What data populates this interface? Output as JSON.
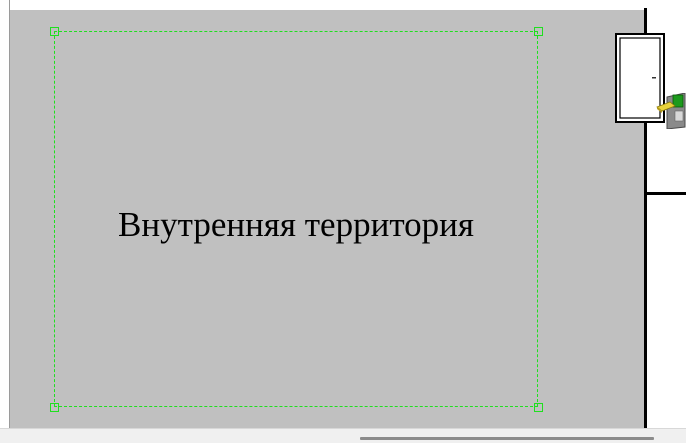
{
  "zone": {
    "label": "Внутренняя территория",
    "fill_color": "#c0c0c0",
    "selection_color": "#1ee01e"
  },
  "icons": {
    "door": "door-icon",
    "card_reader": "card-reader-icon"
  }
}
